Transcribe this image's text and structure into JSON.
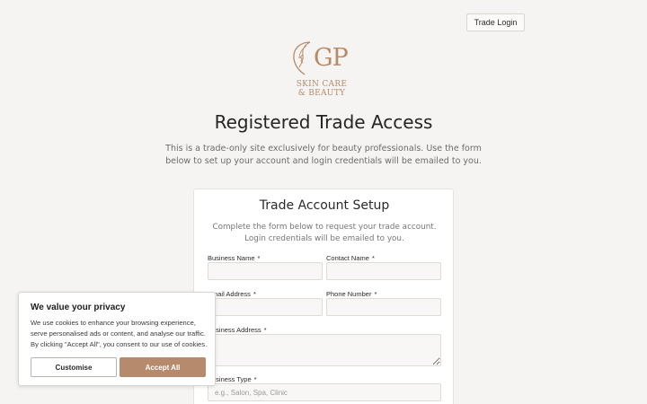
{
  "header": {
    "trade_login_label": "Trade Login"
  },
  "logo": {
    "monogram": "GP",
    "line1": "SKIN CARE",
    "line2": "& BEAUTY",
    "color": "#b68b68"
  },
  "page": {
    "title": "Registered Trade Access",
    "intro": "This is a trade-only site exclusively for beauty professionals. Use the form below to set up your account and login credentials will be emailed to you."
  },
  "form": {
    "title": "Trade Account Setup",
    "subtitle": "Complete the form below to request your trade account. Login credentials will be emailed to you.",
    "required_marker": "*",
    "fields": {
      "business_name": {
        "label": "Business Name",
        "value": ""
      },
      "contact_name": {
        "label": "Contact Name",
        "value": ""
      },
      "email_address": {
        "label": "Email Address",
        "value": ""
      },
      "phone_number": {
        "label": "Phone Number",
        "value": ""
      },
      "business_address": {
        "label": "Business Address",
        "value": ""
      },
      "business_type": {
        "label": "Business Type",
        "placeholder": "e.g., Salon, Spa, Clinic"
      }
    }
  },
  "cookie_banner": {
    "title": "We value your privacy",
    "text": "We use cookies to enhance your browsing experience, serve personalised ads or content, and analyse our traffic. By clicking \"Accept All\", you consent to our use of cookies.",
    "customise_label": "Customise",
    "accept_label": "Accept All",
    "accent_color": "#b68b6d"
  }
}
